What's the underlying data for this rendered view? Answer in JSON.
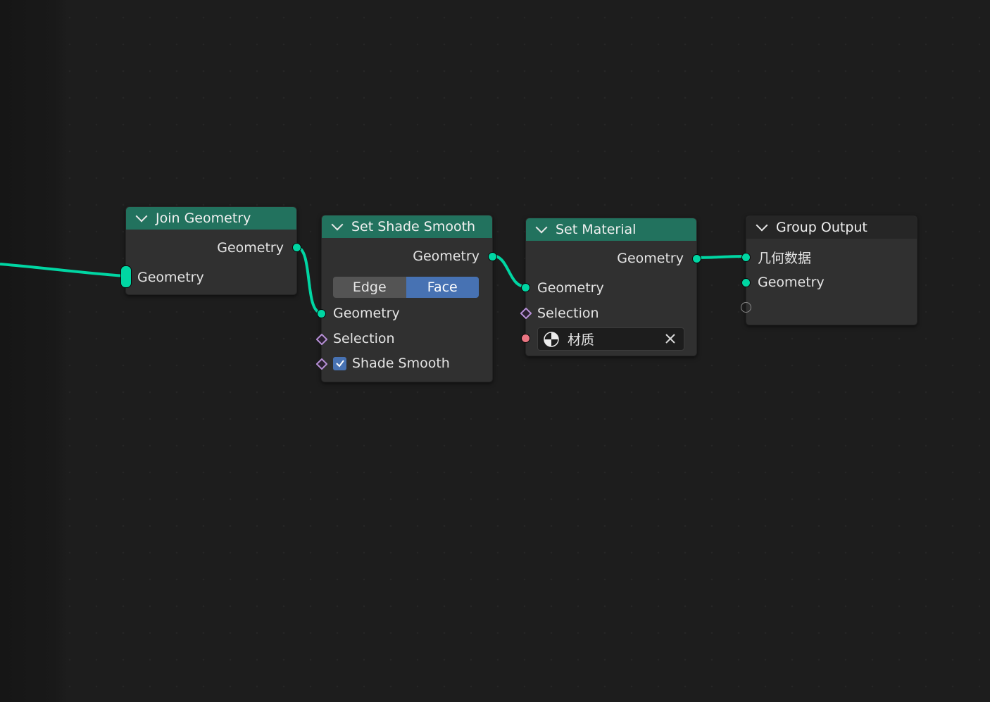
{
  "nodes": {
    "join_geometry": {
      "title": "Join Geometry",
      "output": "Geometry",
      "input": "Geometry"
    },
    "set_shade_smooth": {
      "title": "Set Shade Smooth",
      "output": "Geometry",
      "domain_options": [
        "Edge",
        "Face"
      ],
      "domain_selected": "Face",
      "inputs": {
        "geometry": "Geometry",
        "selection": "Selection",
        "shade_smooth": "Shade Smooth"
      },
      "shade_smooth_checked": true
    },
    "set_material": {
      "title": "Set Material",
      "output": "Geometry",
      "inputs": {
        "geometry": "Geometry",
        "selection": "Selection"
      },
      "material_value": "材质"
    },
    "group_output": {
      "title": "Group Output",
      "inputs": [
        "几何数据",
        "Geometry"
      ]
    }
  },
  "colors": {
    "geometry_socket": "#00d6a3",
    "field_socket": "#b68fd6",
    "material_socket": "#eb7582",
    "header_geometry": "#22725e",
    "header_output": "#262626",
    "toggle_active": "#4772b3"
  }
}
